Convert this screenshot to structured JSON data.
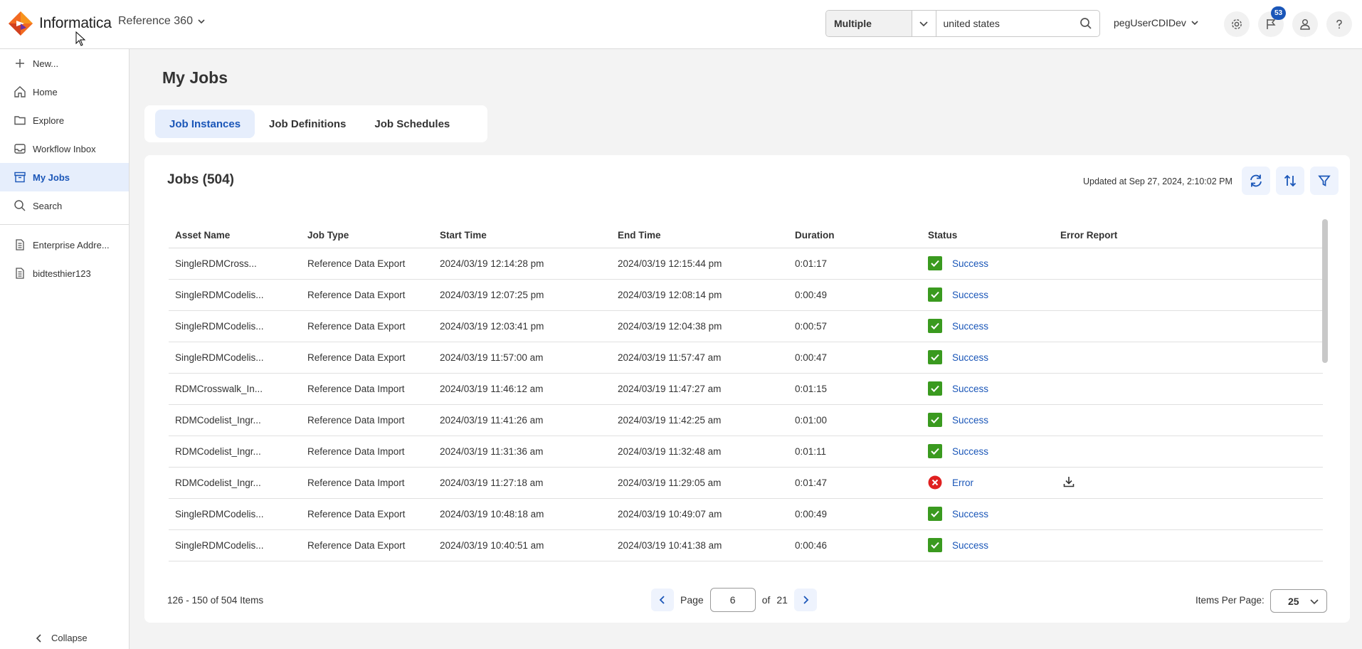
{
  "header": {
    "brand": "Informatica",
    "app_name": "Reference 360",
    "search": {
      "scope": "Multiple",
      "value": "united states"
    },
    "user": "pegUserCDIDev",
    "notifications_count": "53"
  },
  "sidebar": {
    "items": [
      {
        "label": "New..."
      },
      {
        "label": "Home"
      },
      {
        "label": "Explore"
      },
      {
        "label": "Workflow Inbox"
      },
      {
        "label": "My Jobs"
      },
      {
        "label": "Search"
      }
    ],
    "recent": [
      {
        "label": "Enterprise Addre..."
      },
      {
        "label": "bidtesthier123"
      }
    ],
    "collapse_label": "Collapse"
  },
  "page": {
    "title": "My Jobs",
    "tabs": [
      {
        "label": "Job Instances"
      },
      {
        "label": "Job Definitions"
      },
      {
        "label": "Job Schedules"
      }
    ]
  },
  "jobs": {
    "title": "Jobs (504)",
    "updated": "Updated at Sep 27, 2024, 2:10:02 PM",
    "columns": [
      "Asset Name",
      "Job Type",
      "Start Time",
      "End Time",
      "Duration",
      "Status",
      "Error Report"
    ],
    "rows": [
      {
        "asset": "SingleRDMCross...",
        "type": "Reference Data Export",
        "start": "2024/03/19 12:14:28 pm",
        "end": "2024/03/19 12:15:44 pm",
        "duration": "0:01:17",
        "status": "Success"
      },
      {
        "asset": "SingleRDMCodelis...",
        "type": "Reference Data Export",
        "start": "2024/03/19 12:07:25 pm",
        "end": "2024/03/19 12:08:14 pm",
        "duration": "0:00:49",
        "status": "Success"
      },
      {
        "asset": "SingleRDMCodelis...",
        "type": "Reference Data Export",
        "start": "2024/03/19 12:03:41 pm",
        "end": "2024/03/19 12:04:38 pm",
        "duration": "0:00:57",
        "status": "Success"
      },
      {
        "asset": "SingleRDMCodelis...",
        "type": "Reference Data Export",
        "start": "2024/03/19 11:57:00 am",
        "end": "2024/03/19 11:57:47 am",
        "duration": "0:00:47",
        "status": "Success"
      },
      {
        "asset": "RDMCrosswalk_In...",
        "type": "Reference Data Import",
        "start": "2024/03/19 11:46:12 am",
        "end": "2024/03/19 11:47:27 am",
        "duration": "0:01:15",
        "status": "Success"
      },
      {
        "asset": "RDMCodelist_Ingr...",
        "type": "Reference Data Import",
        "start": "2024/03/19 11:41:26 am",
        "end": "2024/03/19 11:42:25 am",
        "duration": "0:01:00",
        "status": "Success"
      },
      {
        "asset": "RDMCodelist_Ingr...",
        "type": "Reference Data Import",
        "start": "2024/03/19 11:31:36 am",
        "end": "2024/03/19 11:32:48 am",
        "duration": "0:01:11",
        "status": "Success"
      },
      {
        "asset": "RDMCodelist_Ingr...",
        "type": "Reference Data Import",
        "start": "2024/03/19 11:27:18 am",
        "end": "2024/03/19 11:29:05 am",
        "duration": "0:01:47",
        "status": "Error"
      },
      {
        "asset": "SingleRDMCodelis...",
        "type": "Reference Data Export",
        "start": "2024/03/19 10:48:18 am",
        "end": "2024/03/19 10:49:07 am",
        "duration": "0:00:49",
        "status": "Success"
      },
      {
        "asset": "SingleRDMCodelis...",
        "type": "Reference Data Export",
        "start": "2024/03/19 10:40:51 am",
        "end": "2024/03/19 10:41:38 am",
        "duration": "0:00:46",
        "status": "Success"
      }
    ]
  },
  "pagination": {
    "range": "126 - 150 of 504 Items",
    "page_label": "Page",
    "current_page": "6",
    "of_label": "of",
    "total_pages": "21",
    "items_per_page_label": "Items Per Page:",
    "items_per_page": "25"
  },
  "colors": {
    "accent": "#1a56b8",
    "success": "#3a9a1f",
    "error": "#e02020"
  }
}
